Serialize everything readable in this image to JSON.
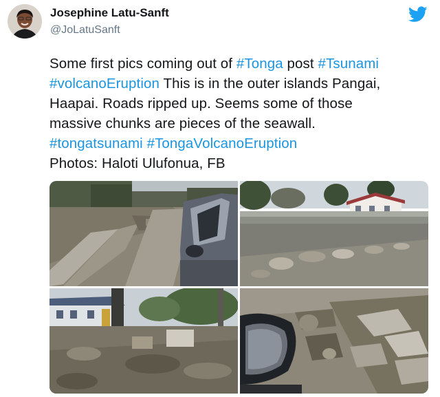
{
  "tweet": {
    "author_name": "Josephine Latu-Sanft",
    "author_handle": "@JoLatuSanft",
    "lines": [
      [
        {
          "t": "Some first pics coming out of ",
          "tag": false
        },
        {
          "t": "#Tonga",
          "tag": true
        },
        {
          "t": " post ",
          "tag": false
        },
        {
          "t": "#Tsunami",
          "tag": true
        }
      ],
      [
        {
          "t": "#volcanoEruption",
          "tag": true
        },
        {
          "t": " This is in the outer islands Pangai,",
          "tag": false
        }
      ],
      [
        {
          "t": "Haapai. Roads ripped up. Seems some of those",
          "tag": false
        }
      ],
      [
        {
          "t": "massive chunks are pieces of the seawall.",
          "tag": false
        }
      ],
      [
        {
          "t": "#tongatsunami",
          "tag": true
        },
        {
          "t": " ",
          "tag": false
        },
        {
          "t": "#TongaVolcanoEruption",
          "tag": true
        }
      ],
      [
        {
          "t": "Photos: Haloti Ulufonua, FB",
          "tag": false
        }
      ]
    ]
  },
  "icons": {
    "brand": "twitter-bird-icon"
  },
  "colors": {
    "hashtag": "#1b95e0",
    "text": "#14171a",
    "handle": "#657786",
    "brand": "#1da1f2"
  },
  "photos": [
    {
      "name": "damaged-road-with-car"
    },
    {
      "name": "broken-seawall-and-house"
    },
    {
      "name": "debris-in-village"
    },
    {
      "name": "rocks-beside-car-mirror"
    }
  ]
}
